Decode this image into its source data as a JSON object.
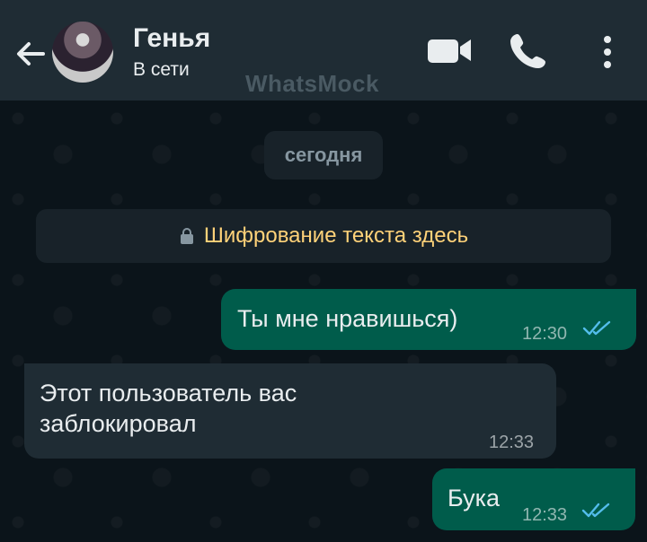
{
  "header": {
    "contact_name": "Генья",
    "status": "В сети",
    "watermark": "WhatsMock",
    "icons": {
      "back": "arrow-left-icon",
      "video": "video-call-icon",
      "phone": "phone-icon",
      "more": "more-vertical-icon"
    }
  },
  "chat": {
    "date_label": "сегодня",
    "encryption_notice": "Шифрование текста здесь",
    "messages": [
      {
        "text": "Ты мне нравишься)",
        "time": "12:30",
        "direction": "outgoing",
        "read": true
      },
      {
        "text": "Этот пользователь вас заблокировал",
        "time": "12:33",
        "direction": "incoming"
      },
      {
        "text": "Бука",
        "time": "12:33",
        "direction": "outgoing",
        "read": true
      }
    ]
  },
  "colors": {
    "header_bg": "#1f2c34",
    "chat_bg": "#0b141a",
    "outgoing_bubble": "#005c4b",
    "incoming_bubble": "#1f2c34",
    "encryption_text": "#ffd279",
    "read_tick": "#53bdeb"
  }
}
